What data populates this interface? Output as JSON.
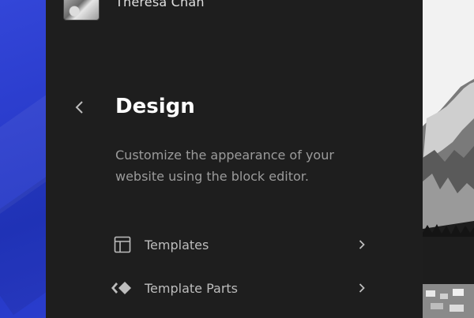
{
  "user": {
    "name": "Theresa Chan"
  },
  "header": {
    "title": "Design",
    "description": "Customize the appearance of your website using the block editor."
  },
  "menu": {
    "items": [
      {
        "label": "Templates",
        "icon": "templates-icon"
      },
      {
        "label": "Template Parts",
        "icon": "template-parts-icon"
      }
    ]
  },
  "colors": {
    "panel_bg": "#1e1e1e",
    "accent_blue": "#2a3ccc",
    "title": "#ffffff",
    "muted_text": "#9b9b9b"
  }
}
